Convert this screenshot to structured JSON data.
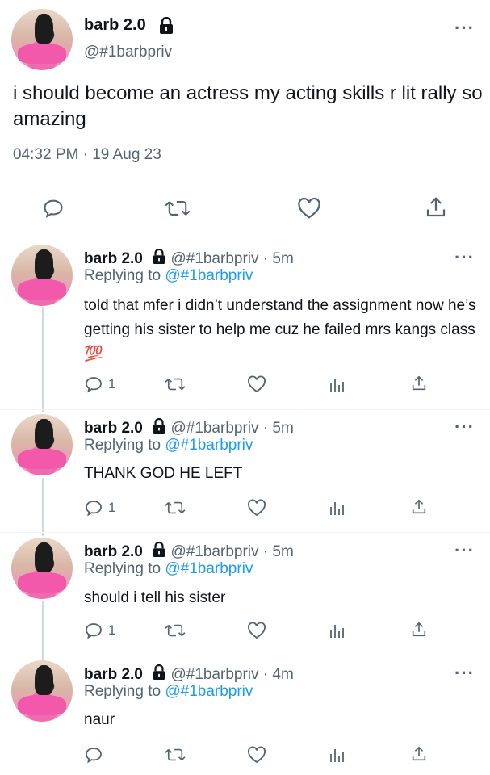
{
  "main_tweet": {
    "display_name": "barb 2.0",
    "handle": "@#1barbpriv",
    "text": "i should become an actress my acting skills r lit rally so amazing",
    "timestamp": "04:32 PM · 19 Aug 23",
    "actions": [
      "reply-icon",
      "retweet-icon",
      "like-icon",
      "share-icon"
    ]
  },
  "replies": [
    {
      "display_name": "barb 2.0",
      "handle": "@#1barbpriv",
      "time": "· 5m",
      "replying_prefix": "Replying to",
      "replying_handle": "@#1barbpriv",
      "text": "told that mfer i didn’t understand the assignment now he’s getting his sister to help me cuz he failed mrs kangs class 💯",
      "reply_count": "1"
    },
    {
      "display_name": "barb 2.0",
      "handle": "@#1barbpriv",
      "time": "· 5m",
      "replying_prefix": "Replying to",
      "replying_handle": "@#1barbpriv",
      "text": "THANK GOD HE LEFT",
      "reply_count": "1"
    },
    {
      "display_name": "barb 2.0",
      "handle": "@#1barbpriv",
      "time": "· 5m",
      "replying_prefix": "Replying to",
      "replying_handle": "@#1barbpriv",
      "text": "should i tell his sister",
      "reply_count": "1"
    },
    {
      "display_name": "barb 2.0",
      "handle": "@#1barbpriv",
      "time": "· 4m",
      "replying_prefix": "Replying to",
      "replying_handle": "@#1barbpriv",
      "text": "naur",
      "reply_count": ""
    }
  ],
  "colors": {
    "accent": "#1d9bf0",
    "muted": "#536471",
    "text": "#0f1419"
  }
}
